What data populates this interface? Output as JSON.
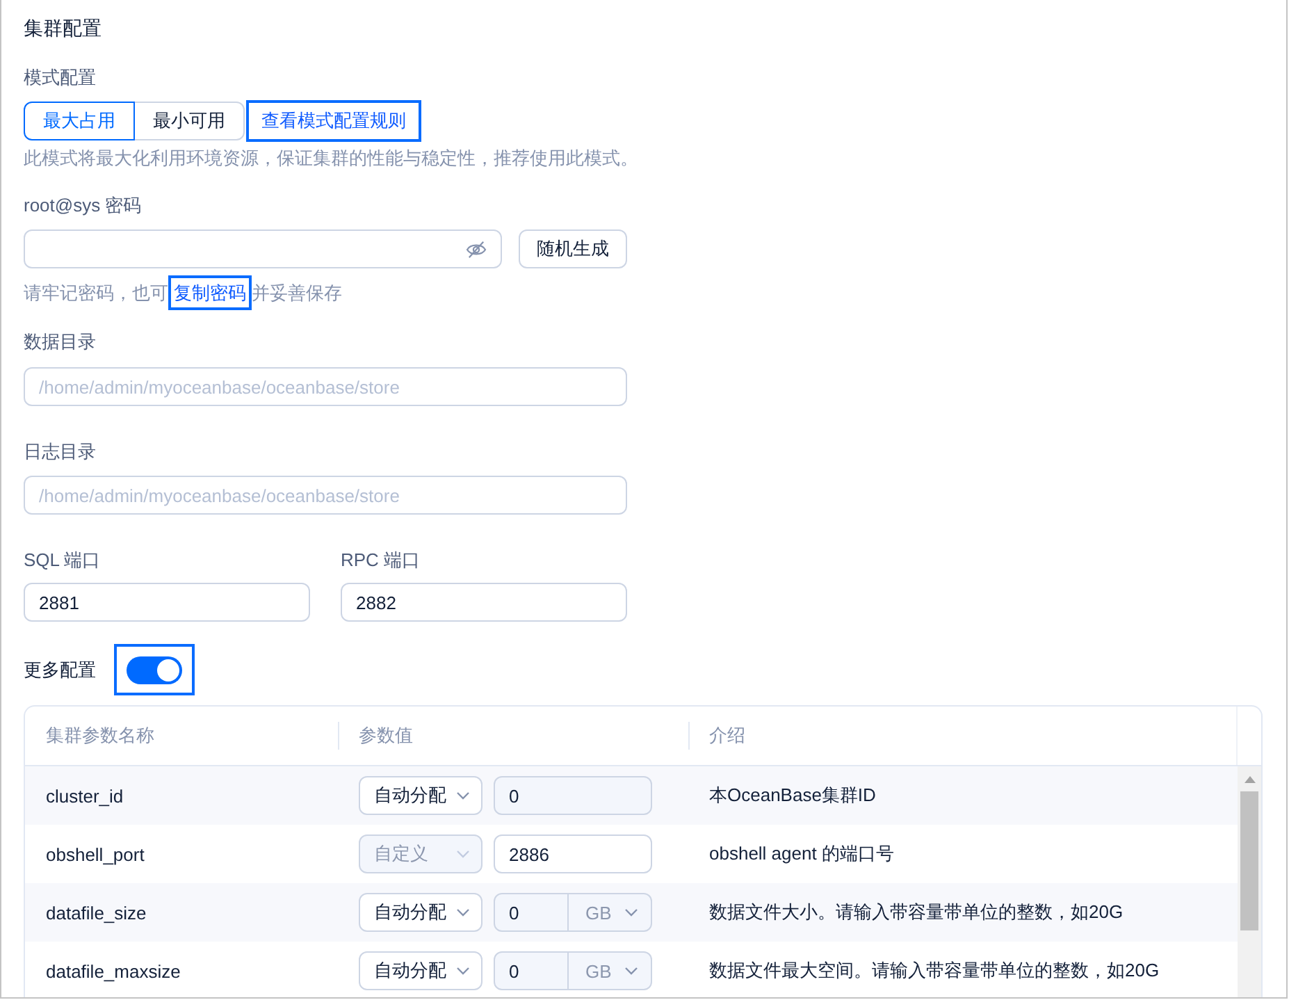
{
  "section_title": "集群配置",
  "mode": {
    "label": "模式配置",
    "options": [
      {
        "label": "最大占用",
        "selected": true
      },
      {
        "label": "最小可用",
        "selected": false
      }
    ],
    "rules_link": {
      "text": "查看模式配置规则",
      "highlighted": true
    },
    "description": "此模式将最大化利用环境资源，保证集群的性能与稳定性，推荐使用此模式。"
  },
  "password": {
    "label": "root@sys 密码",
    "masked": true,
    "generate_button": "随机生成",
    "hint": {
      "before": "请牢记密码，也可",
      "link": {
        "text": "复制密码",
        "highlighted": true
      },
      "after": "并妥善保存"
    }
  },
  "directories": [
    {
      "label": "数据目录",
      "placeholder": "/home/admin/myoceanbase/oceanbase/store"
    },
    {
      "label": "日志目录",
      "placeholder": "/home/admin/myoceanbase/oceanbase/store"
    }
  ],
  "ports": [
    {
      "label": "SQL 端口",
      "value": "2881"
    },
    {
      "label": "RPC 端口",
      "value": "2882"
    }
  ],
  "more_config": {
    "label": "更多配置",
    "on": true,
    "highlighted": true
  },
  "parameters": {
    "columns": [
      "集群参数名称",
      "参数值",
      "介绍"
    ],
    "rows": [
      {
        "kind": "plain",
        "name": "cluster_id",
        "mode": {
          "text": "自动分配",
          "disabled": false
        },
        "value": {
          "text": "0",
          "disabled": true
        },
        "description": "本OceanBase集群ID"
      },
      {
        "kind": "plain",
        "name": "obshell_port",
        "mode": {
          "text": "自定义",
          "disabled": true
        },
        "value": {
          "text": "2886",
          "disabled": false
        },
        "description": "obshell agent 的端口号"
      },
      {
        "kind": "capacity",
        "name": "datafile_size",
        "mode": {
          "text": "自动分配",
          "disabled": false
        },
        "value": {
          "text": "0",
          "disabled": true
        },
        "unit": {
          "text": "GB",
          "disabled": true
        },
        "description": "数据文件大小。请输入带容量带单位的整数，如20G"
      },
      {
        "kind": "capacity",
        "name": "datafile_maxsize",
        "mode": {
          "text": "自动分配",
          "disabled": false
        },
        "value": {
          "text": "0",
          "disabled": true
        },
        "unit": {
          "text": "GB",
          "disabled": true
        },
        "description": "数据文件最大空间。请输入带容量带单位的整数，如20G"
      }
    ]
  }
}
